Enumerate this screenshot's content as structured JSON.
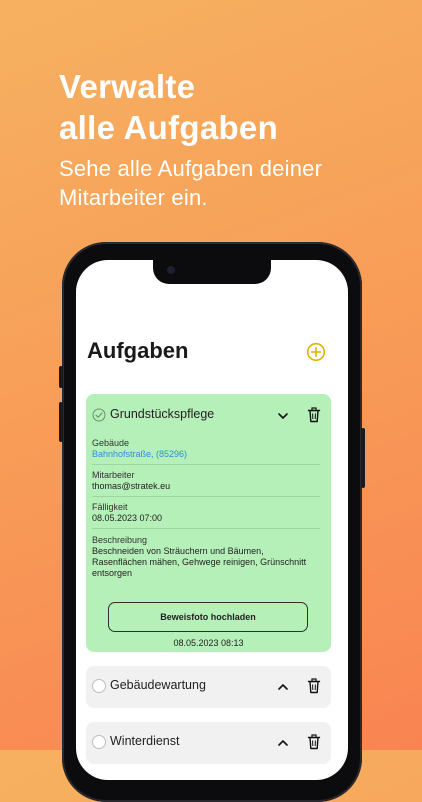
{
  "headline": {
    "line1": "Verwalte",
    "line2": "alle Aufgaben"
  },
  "subline": {
    "line1": "Sehe alle Aufgaben deiner",
    "line2": "Mitarbeiter ein."
  },
  "app": {
    "title": "Aufgaben",
    "tasks": [
      {
        "title": "Grundstückspflege",
        "done": true,
        "expanded": true,
        "fields": {
          "building_label": "Gebäude",
          "building_value": "Bahnhofstraße, (85296)",
          "employee_label": "Mitarbeiter",
          "employee_value": "thomas@stratek.eu",
          "due_label": "Fälligkeit",
          "due_value": "08.05.2023 07:00",
          "desc_label": "Beschreibung",
          "desc_line1": "Beschneiden von Sträuchern und Bäumen,",
          "desc_line2": "Rasenflächen mähen, Gehwege reinigen, Grünschnitt",
          "desc_line3": "entsorgen"
        },
        "proof_button": "Beweisfoto hochladen",
        "timestamp": "08.05.2023 08:13"
      },
      {
        "title": "Gebäudewartung",
        "done": false,
        "expanded": false
      },
      {
        "title": "Winterdienst",
        "done": false,
        "expanded": false
      }
    ]
  },
  "colors": {
    "accent": "#e0b200",
    "done_card": "#b6f0b9",
    "closed_card": "#f1f1f1",
    "link": "#2b8fd6"
  }
}
